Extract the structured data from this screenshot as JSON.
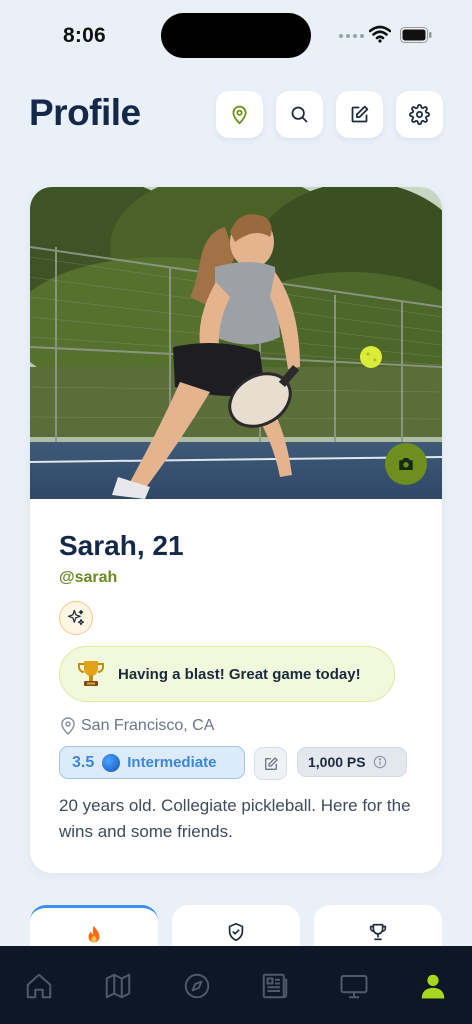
{
  "status_bar": {
    "time": "8:06"
  },
  "header": {
    "title": "Profile",
    "buttons": [
      "map-pin-icon",
      "search-icon",
      "edit-icon",
      "gear-icon"
    ]
  },
  "profile": {
    "name_age": "Sarah, 21",
    "handle": "@sarah",
    "status_message": "Having a blast! Great game today!",
    "location": "San Francisco, CA",
    "rating": "3.5",
    "level": "Intermediate",
    "points": "1,000 PS",
    "bio": "20 years old. Collegiate pickleball. Here for the wins and some friends."
  },
  "tabs": [
    "flame-icon",
    "shield-check-icon",
    "trophy-icon"
  ],
  "bottom_nav": {
    "items": [
      "home-icon",
      "map-icon",
      "compass-icon",
      "news-icon",
      "tv-icon",
      "profile-icon"
    ],
    "active": "profile-icon"
  },
  "colors": {
    "accent_green": "#6e8f1e",
    "handle_green": "#6b8a28",
    "rating_blue": "#3d86d8",
    "title_navy": "#14284a",
    "nav_bg": "#0e1726",
    "nav_active": "#a6d61e"
  }
}
